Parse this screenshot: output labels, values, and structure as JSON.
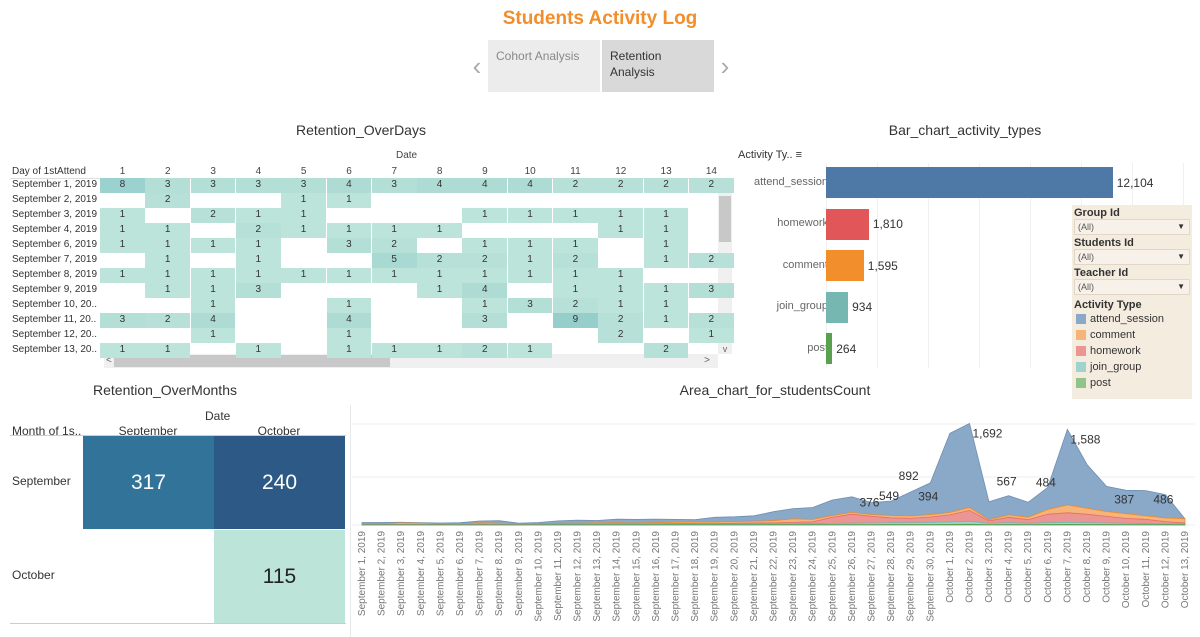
{
  "header": {
    "title": "Students Activity Log",
    "prev_icon": "chevron-left-icon",
    "next_icon": "chevron-right-icon",
    "tabs": [
      {
        "label": "Cohort Analysis",
        "active": false
      },
      {
        "label": "Retention Analysis",
        "active": true
      }
    ]
  },
  "retention_days": {
    "title": "Retention_OverDays",
    "column_group_label": "Date",
    "row_header": "Day of 1stAttend",
    "columns": [
      "1",
      "2",
      "3",
      "4",
      "5",
      "6",
      "7",
      "8",
      "9",
      "10",
      "11",
      "12",
      "13",
      "14"
    ],
    "rows": [
      {
        "label": "September 1, 2019",
        "values": [
          8,
          3,
          3,
          3,
          3,
          4,
          3,
          4,
          4,
          4,
          2,
          2,
          2,
          2
        ]
      },
      {
        "label": "September 2, 2019",
        "values": [
          null,
          2,
          null,
          null,
          1,
          1,
          null,
          null,
          null,
          null,
          null,
          null,
          null,
          null
        ]
      },
      {
        "label": "September 3, 2019",
        "values": [
          1,
          null,
          2,
          1,
          1,
          null,
          null,
          null,
          1,
          1,
          1,
          1,
          1,
          null
        ]
      },
      {
        "label": "September 4, 2019",
        "values": [
          1,
          1,
          null,
          2,
          1,
          1,
          1,
          1,
          null,
          null,
          null,
          1,
          1,
          null
        ]
      },
      {
        "label": "September 6, 2019",
        "values": [
          1,
          1,
          1,
          1,
          null,
          3,
          2,
          null,
          1,
          1,
          1,
          null,
          1,
          null
        ]
      },
      {
        "label": "September 7, 2019",
        "values": [
          null,
          1,
          null,
          1,
          null,
          null,
          5,
          2,
          2,
          1,
          2,
          null,
          1,
          2
        ]
      },
      {
        "label": "September 8, 2019",
        "values": [
          1,
          1,
          1,
          1,
          1,
          1,
          1,
          1,
          1,
          1,
          1,
          1,
          null,
          null
        ]
      },
      {
        "label": "September 9, 2019",
        "values": [
          null,
          1,
          1,
          3,
          null,
          null,
          null,
          1,
          4,
          null,
          1,
          1,
          1,
          3
        ]
      },
      {
        "label": "September 10, 20..",
        "values": [
          null,
          null,
          1,
          null,
          null,
          1,
          null,
          null,
          1,
          3,
          2,
          1,
          1,
          null
        ]
      },
      {
        "label": "September 11, 20..",
        "values": [
          3,
          2,
          4,
          null,
          null,
          4,
          null,
          null,
          3,
          null,
          9,
          2,
          1,
          2
        ]
      },
      {
        "label": "September 12, 20..",
        "values": [
          null,
          null,
          1,
          null,
          null,
          1,
          null,
          null,
          null,
          null,
          null,
          2,
          null,
          1
        ]
      },
      {
        "label": "September 13, 20..",
        "values": [
          1,
          1,
          null,
          1,
          null,
          1,
          1,
          1,
          2,
          1,
          null,
          null,
          2,
          null
        ]
      }
    ],
    "scroll_up": "^",
    "scroll_down": "v",
    "scroll_left": "<",
    "scroll_right": ">"
  },
  "retention_months": {
    "title": "Retention_OverMonths",
    "column_group_label": "Date",
    "row_header": "Month of 1s..",
    "columns": [
      "September",
      "October"
    ],
    "rows": [
      {
        "label": "September",
        "values": [
          317,
          240
        ]
      },
      {
        "label": "October",
        "values": [
          null,
          115
        ]
      }
    ]
  },
  "filters": [
    {
      "label": "Group Id",
      "value": "(All)"
    },
    {
      "label": "Students Id",
      "value": "(All)"
    },
    {
      "label": "Teacher Id",
      "value": "(All)"
    }
  ],
  "legend": {
    "title": "Activity Type",
    "items": [
      {
        "label": "attend_session",
        "color": "#8aa8c8"
      },
      {
        "label": "comment",
        "color": "#f7b478"
      },
      {
        "label": "homework",
        "color": "#ec9595"
      },
      {
        "label": "join_group",
        "color": "#9fd3cd"
      },
      {
        "label": "post",
        "color": "#91c48a"
      }
    ]
  },
  "chart_data": [
    {
      "type": "bar",
      "title": "Bar_chart_activity_types",
      "header": "Activity Ty..",
      "sort_icon": "sort-descending-icon",
      "categories": [
        "attend_session",
        "homework",
        "comment",
        "join_group",
        "post"
      ],
      "values": [
        12104,
        1810,
        1595,
        934,
        264
      ],
      "value_labels": [
        "12,104",
        "1,810",
        "1,595",
        "934",
        "264"
      ],
      "colors": [
        "#4e79a7",
        "#e15759",
        "#f28e2b",
        "#76b7b2",
        "#59a14f"
      ],
      "xlim": [
        0,
        13000
      ]
    },
    {
      "type": "area",
      "title": "Area_chart_for_studentsCount",
      "stacked": true,
      "x": [
        "September 1, 2019",
        "September 2, 2019",
        "September 3, 2019",
        "September 4, 2019",
        "September 5, 2019",
        "September 6, 2019",
        "September 7, 2019",
        "September 8, 2019",
        "September 9, 2019",
        "September 10, 2019",
        "September 11, 2019",
        "September 12, 2019",
        "September 13, 2019",
        "September 14, 2019",
        "September 15, 2019",
        "September 16, 2019",
        "September 17, 2019",
        "September 18, 2019",
        "September 19, 2019",
        "September 20, 2019",
        "September 21, 2019",
        "September 22, 2019",
        "September 23, 2019",
        "September 24, 2019",
        "September 25, 2019",
        "September 26, 2019",
        "September 27, 2019",
        "September 28, 2019",
        "September 29, 2019",
        "September 30, 2019",
        "October 1, 2019",
        "October 2, 2019",
        "October 3, 2019",
        "October 4, 2019",
        "October 5, 2019",
        "October 6, 2019",
        "October 7, 2019",
        "October 8, 2019",
        "October 9, 2019",
        "October 10, 2019",
        "October 11, 2019",
        "October 12, 2019",
        "October 13, 2019"
      ],
      "series": [
        {
          "name": "post",
          "values": [
            2,
            2,
            2,
            2,
            2,
            2,
            2,
            2,
            2,
            2,
            3,
            3,
            3,
            3,
            3,
            3,
            3,
            3,
            4,
            4,
            4,
            5,
            5,
            5,
            6,
            6,
            6,
            8,
            8,
            8,
            10,
            12,
            6,
            8,
            6,
            8,
            10,
            8,
            8,
            6,
            6,
            5,
            4
          ]
        },
        {
          "name": "join_group",
          "values": [
            4,
            4,
            4,
            4,
            4,
            4,
            4,
            4,
            4,
            5,
            6,
            6,
            6,
            6,
            6,
            6,
            8,
            8,
            8,
            10,
            10,
            12,
            14,
            16,
            20,
            24,
            28,
            30,
            32,
            34,
            38,
            50,
            20,
            30,
            22,
            30,
            34,
            30,
            26,
            22,
            18,
            12,
            10
          ]
        },
        {
          "name": "homework",
          "values": [
            6,
            6,
            4,
            4,
            4,
            4,
            8,
            6,
            4,
            4,
            6,
            6,
            8,
            10,
            8,
            10,
            10,
            14,
            12,
            14,
            20,
            18,
            24,
            30,
            100,
            150,
            110,
            80,
            70,
            90,
            120,
            180,
            40,
            90,
            60,
            140,
            160,
            140,
            110,
            80,
            70,
            40,
            20
          ]
        },
        {
          "name": "comment",
          "values": [
            10,
            10,
            25,
            20,
            8,
            8,
            22,
            20,
            10,
            10,
            14,
            16,
            18,
            18,
            16,
            20,
            22,
            24,
            24,
            28,
            30,
            36,
            60,
            40,
            30,
            30,
            30,
            40,
            40,
            40,
            40,
            50,
            20,
            40,
            40,
            80,
            130,
            100,
            80,
            80,
            60,
            60,
            70
          ]
        },
        {
          "name": "attend_session",
          "values": [
            20,
            20,
            10,
            10,
            16,
            20,
            30,
            40,
            10,
            20,
            40,
            50,
            40,
            60,
            60,
            60,
            50,
            40,
            80,
            80,
            90,
            150,
            170,
            200,
            260,
            260,
            200,
            240,
            400,
            530,
            1320,
            1400,
            300,
            320,
            250,
            370,
            1260,
            730,
            420,
            390,
            420,
            390,
            0
          ]
        }
      ],
      "data_labels": [
        {
          "x": "September 27, 2019",
          "label": "376"
        },
        {
          "x": "September 28, 2019",
          "label": "549"
        },
        {
          "x": "September 29, 2019",
          "label": "892"
        },
        {
          "x": "September 30, 2019",
          "label": "394"
        },
        {
          "x": "October 2, 2019",
          "label": "1,692"
        },
        {
          "x": "October 4, 2019",
          "label": "567"
        },
        {
          "x": "October 6, 2019",
          "label": "484"
        },
        {
          "x": "October 7, 2019",
          "label": "1,588"
        },
        {
          "x": "October 10, 2019",
          "label": "387"
        },
        {
          "x": "October 12, 2019",
          "label": "486"
        }
      ],
      "ylim": [
        0,
        1750
      ],
      "grid": true
    }
  ]
}
